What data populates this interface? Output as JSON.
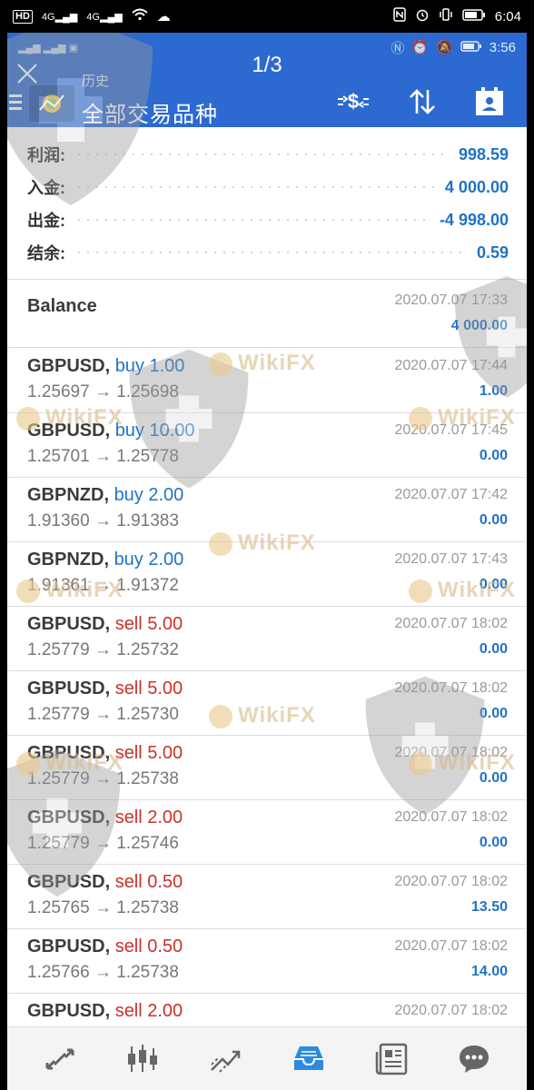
{
  "outer_status": {
    "left_icons": [
      "HD",
      "4G",
      "4G"
    ],
    "time": "6:04"
  },
  "inner_status": {
    "time": "3:56"
  },
  "viewer": {
    "page_indicator": "1/3",
    "close_icon": "close-icon"
  },
  "toolbar": {
    "subtitle": "历史",
    "title": "全部交易品种",
    "icons": [
      "currency-filter-icon",
      "sort-icon",
      "calendar-icon"
    ],
    "accent": "#2c6ad1"
  },
  "summary": {
    "rows": [
      {
        "label": "利润:",
        "value": "998.59"
      },
      {
        "label": "入金:",
        "value": "4 000.00"
      },
      {
        "label": "出金:",
        "value": "-4 998.00"
      },
      {
        "label": "结余:",
        "value": "0.59"
      }
    ]
  },
  "balance": {
    "label": "Balance",
    "time": "2020.07.07 17:33",
    "amount": "4 000.00"
  },
  "deals": [
    {
      "symbol": "GBPUSD,",
      "type": "buy",
      "type_label": "buy 1.00",
      "prices": "1.25697 → 1.25698",
      "time": "2020.07.07 17:44",
      "profit": "1.00"
    },
    {
      "symbol": "GBPUSD,",
      "type": "buy",
      "type_label": "buy 10.00",
      "prices": "1.25701 → 1.25778",
      "time": "2020.07.07 17:45",
      "profit": "0.00"
    },
    {
      "symbol": "GBPNZD,",
      "type": "buy",
      "type_label": "buy 2.00",
      "prices": "1.91360 → 1.91383",
      "time": "2020.07.07 17:42",
      "profit": "0.00"
    },
    {
      "symbol": "GBPNZD,",
      "type": "buy",
      "type_label": "buy 2.00",
      "prices": "1.91361 → 1.91372",
      "time": "2020.07.07 17:43",
      "profit": "0.00"
    },
    {
      "symbol": "GBPUSD,",
      "type": "sell",
      "type_label": "sell 5.00",
      "prices": "1.25779 → 1.25732",
      "time": "2020.07.07 18:02",
      "profit": "0.00"
    },
    {
      "symbol": "GBPUSD,",
      "type": "sell",
      "type_label": "sell 5.00",
      "prices": "1.25779 → 1.25730",
      "time": "2020.07.07 18:02",
      "profit": "0.00"
    },
    {
      "symbol": "GBPUSD,",
      "type": "sell",
      "type_label": "sell 5.00",
      "prices": "1.25779 → 1.25738",
      "time": "2020.07.07 18:02",
      "profit": "0.00"
    },
    {
      "symbol": "GBPUSD,",
      "type": "sell",
      "type_label": "sell 2.00",
      "prices": "1.25779 → 1.25746",
      "time": "2020.07.07 18:02",
      "profit": "0.00"
    },
    {
      "symbol": "GBPUSD,",
      "type": "sell",
      "type_label": "sell 0.50",
      "prices": "1.25765 → 1.25738",
      "time": "2020.07.07 18:02",
      "profit": "13.50"
    },
    {
      "symbol": "GBPUSD,",
      "type": "sell",
      "type_label": "sell 0.50",
      "prices": "1.25766 → 1.25738",
      "time": "2020.07.07 18:02",
      "profit": "14.00"
    },
    {
      "symbol": "GBPUSD,",
      "type": "sell",
      "type_label": "sell 2.00",
      "prices": "",
      "time": "2020.07.07 18:02",
      "profit": ""
    }
  ],
  "bottom_nav": [
    {
      "name": "nav-quotes",
      "icon": "quotes-icon"
    },
    {
      "name": "nav-chart",
      "icon": "candlestick-icon"
    },
    {
      "name": "nav-trade",
      "icon": "trade-icon"
    },
    {
      "name": "nav-history",
      "icon": "history-inbox-icon",
      "active": true
    },
    {
      "name": "nav-news",
      "icon": "news-icon"
    },
    {
      "name": "nav-chat",
      "icon": "chat-icon"
    }
  ],
  "watermark": {
    "text": "WikiFX"
  },
  "colors": {
    "buy": "#1e73c8",
    "sell": "#c8322c",
    "profit": "#1e73c8"
  }
}
